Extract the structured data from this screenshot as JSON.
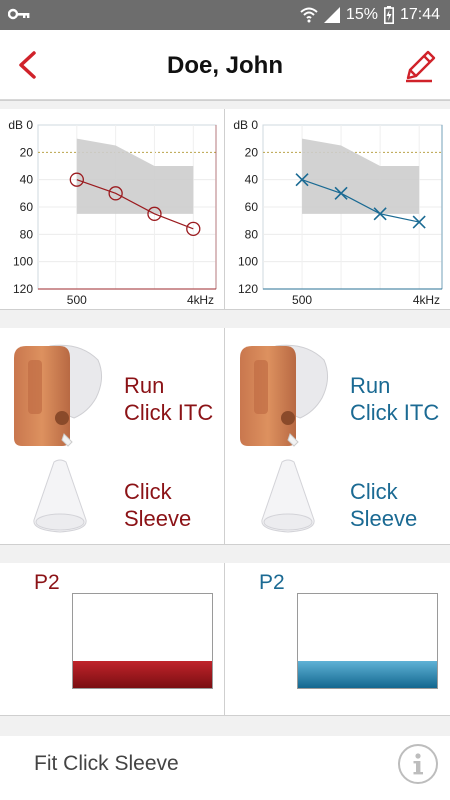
{
  "status_bar": {
    "battery_percent": "15%",
    "time": "17:44",
    "icons": [
      "key-icon",
      "wifi-icon",
      "signal-icon",
      "battery-icon"
    ]
  },
  "header": {
    "title": "Doe, John",
    "back_icon": "chevron-left-icon",
    "edit_icon": "pencil-icon"
  },
  "audiogram": {
    "y_axis_label": "dB",
    "y_ticks": [
      "0",
      "20",
      "40",
      "60",
      "80",
      "100",
      "120"
    ],
    "x_ticks": [
      "500",
      "4k"
    ],
    "x_unit": "Hz",
    "left_color": "#9b1b1f",
    "right_color": "#1a6a93"
  },
  "chart_data": [
    {
      "type": "line",
      "title": "",
      "xlabel": "Hz",
      "ylabel": "dB",
      "ylim": [
        0,
        120
      ],
      "y_inverted": true,
      "x_scale": "log",
      "series": [
        {
          "x": [
            500,
            1000,
            2000,
            4000
          ],
          "y": [
            40,
            50,
            65,
            76
          ],
          "marker": "circle",
          "color": "#9b1b1f"
        }
      ],
      "fitting_range": {
        "x": [
          500,
          1000,
          2000,
          4000
        ],
        "upper": [
          10,
          15,
          30,
          30
        ],
        "lower": [
          65,
          65,
          65,
          65
        ]
      }
    },
    {
      "type": "line",
      "title": "",
      "xlabel": "Hz",
      "ylabel": "dB",
      "ylim": [
        0,
        120
      ],
      "y_inverted": true,
      "x_scale": "log",
      "series": [
        {
          "x": [
            500,
            1000,
            2000,
            4000
          ],
          "y": [
            40,
            50,
            65,
            71
          ],
          "marker": "x",
          "color": "#1a6a93"
        }
      ],
      "fitting_range": {
        "x": [
          500,
          1000,
          2000,
          4000
        ],
        "upper": [
          10,
          15,
          30,
          30
        ],
        "lower": [
          65,
          65,
          65,
          65
        ]
      }
    }
  ],
  "devices": {
    "left": {
      "device_line1": "Run",
      "device_line2": "Click ITC",
      "dome_line1": "Click",
      "dome_line2": "Sleeve"
    },
    "right": {
      "device_line1": "Run",
      "device_line2": "Click ITC",
      "dome_line1": "Click",
      "dome_line2": "Sleeve"
    }
  },
  "programs": {
    "left": {
      "label": "P2",
      "color": "#9b1b1f"
    },
    "right": {
      "label": "P2",
      "color": "#1a6a93"
    }
  },
  "footer": {
    "label": "Fit Click Sleeve",
    "info_icon": "info-icon"
  }
}
